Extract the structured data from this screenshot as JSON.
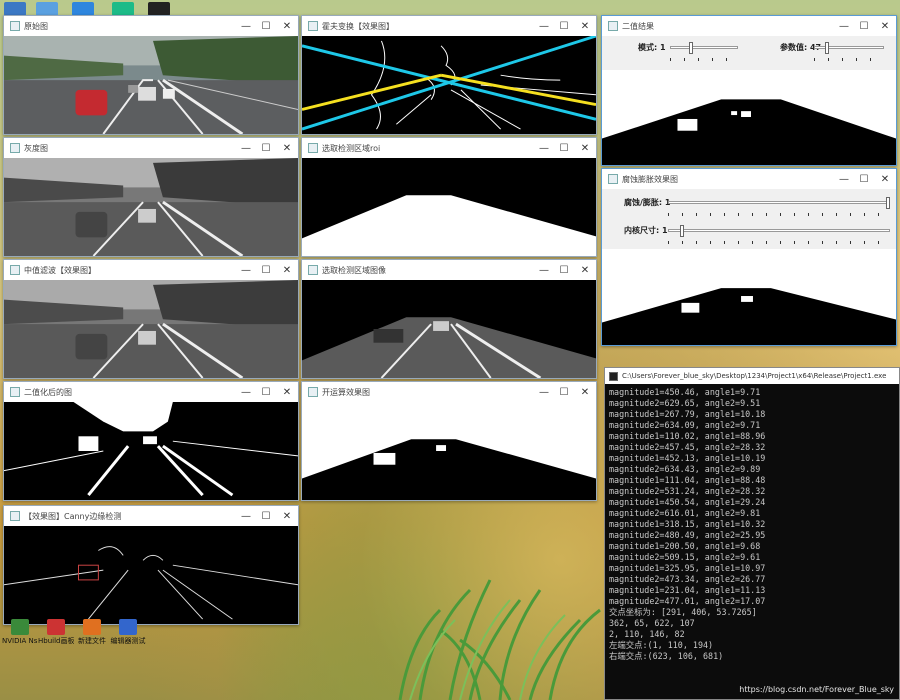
{
  "windows": {
    "original": {
      "title": "原始图"
    },
    "hough": {
      "title": "霍夫变换【效果图】"
    },
    "gray": {
      "title": "灰度图"
    },
    "roi_mask": {
      "title": "选取检测区域roi"
    },
    "median": {
      "title": "中值滤波【效果图】"
    },
    "roi_image": {
      "title": "选取检测区域图像"
    },
    "binary": {
      "title": "二值化后的图"
    },
    "opening": {
      "title": "开运算效果图"
    },
    "canny": {
      "title": "【效果图】Canny边缘检测"
    },
    "threshold": {
      "title": "二值结果",
      "mode_label": "模式: 1",
      "param_label": "参数值: 47",
      "mode_value": 1,
      "param_value": 47
    },
    "morph": {
      "title": "腐蚀膨胀效果图",
      "erode_label": "腐蚀/膨胀: 1",
      "kernel_label": "内核尺寸: 1",
      "erode_value": 1,
      "kernel_value": 1
    }
  },
  "controls": {
    "minimize": "—",
    "maximize": "☐",
    "close": "✕"
  },
  "console": {
    "title": "C:\\Users\\Forever_blue_sky\\Desktop\\1234\\Project1\\x64\\Release\\Project1.exe",
    "lines": [
      "magnitude1=450.46, angle1=9.71",
      "magnitude2=629.65, angle2=9.51",
      "magnitude1=267.79, angle1=10.18",
      "magnitude2=634.09, angle2=9.71",
      "magnitude1=110.02, angle1=88.96",
      "magnitude2=457.45, angle2=28.32",
      "magnitude1=452.13, angle1=10.19",
      "magnitude2=634.43, angle2=9.89",
      "magnitude1=111.04, angle1=88.48",
      "magnitude2=531.24, angle2=28.32",
      "magnitude1=450.54, angle1=29.24",
      "magnitude2=616.01, angle2=9.81",
      "magnitude1=318.15, angle1=10.32",
      "magnitude2=480.49, angle2=25.95",
      "magnitude1=200.50, angle1=9.68",
      "magnitude2=509.15, angle2=9.61",
      "magnitude1=325.95, angle1=10.97",
      "magnitude2=473.34, angle2=26.77",
      "magnitude1=231.04, angle1=11.13",
      "magnitude2=477.01, angle2=17.07",
      "交点坐标为: [291, 406, 53.7265]",
      "362, 65, 622, 107",
      "2, 110, 146, 82",
      "左端交点:(1, 110, 194)",
      "右端交点:(623, 106, 681)"
    ]
  },
  "desktop_icons": [
    {
      "label": "NVIDIA Nsight...",
      "color": "#3a8a3a"
    },
    {
      "label": "Hbuild画板",
      "color": "#cc3333"
    },
    {
      "label": "新建文件",
      "color": "#e07020"
    },
    {
      "label": "编辑器测试",
      "color": "#3366cc"
    }
  ],
  "watermark": "https://blog.csdn.net/Forever_Blue_sky"
}
